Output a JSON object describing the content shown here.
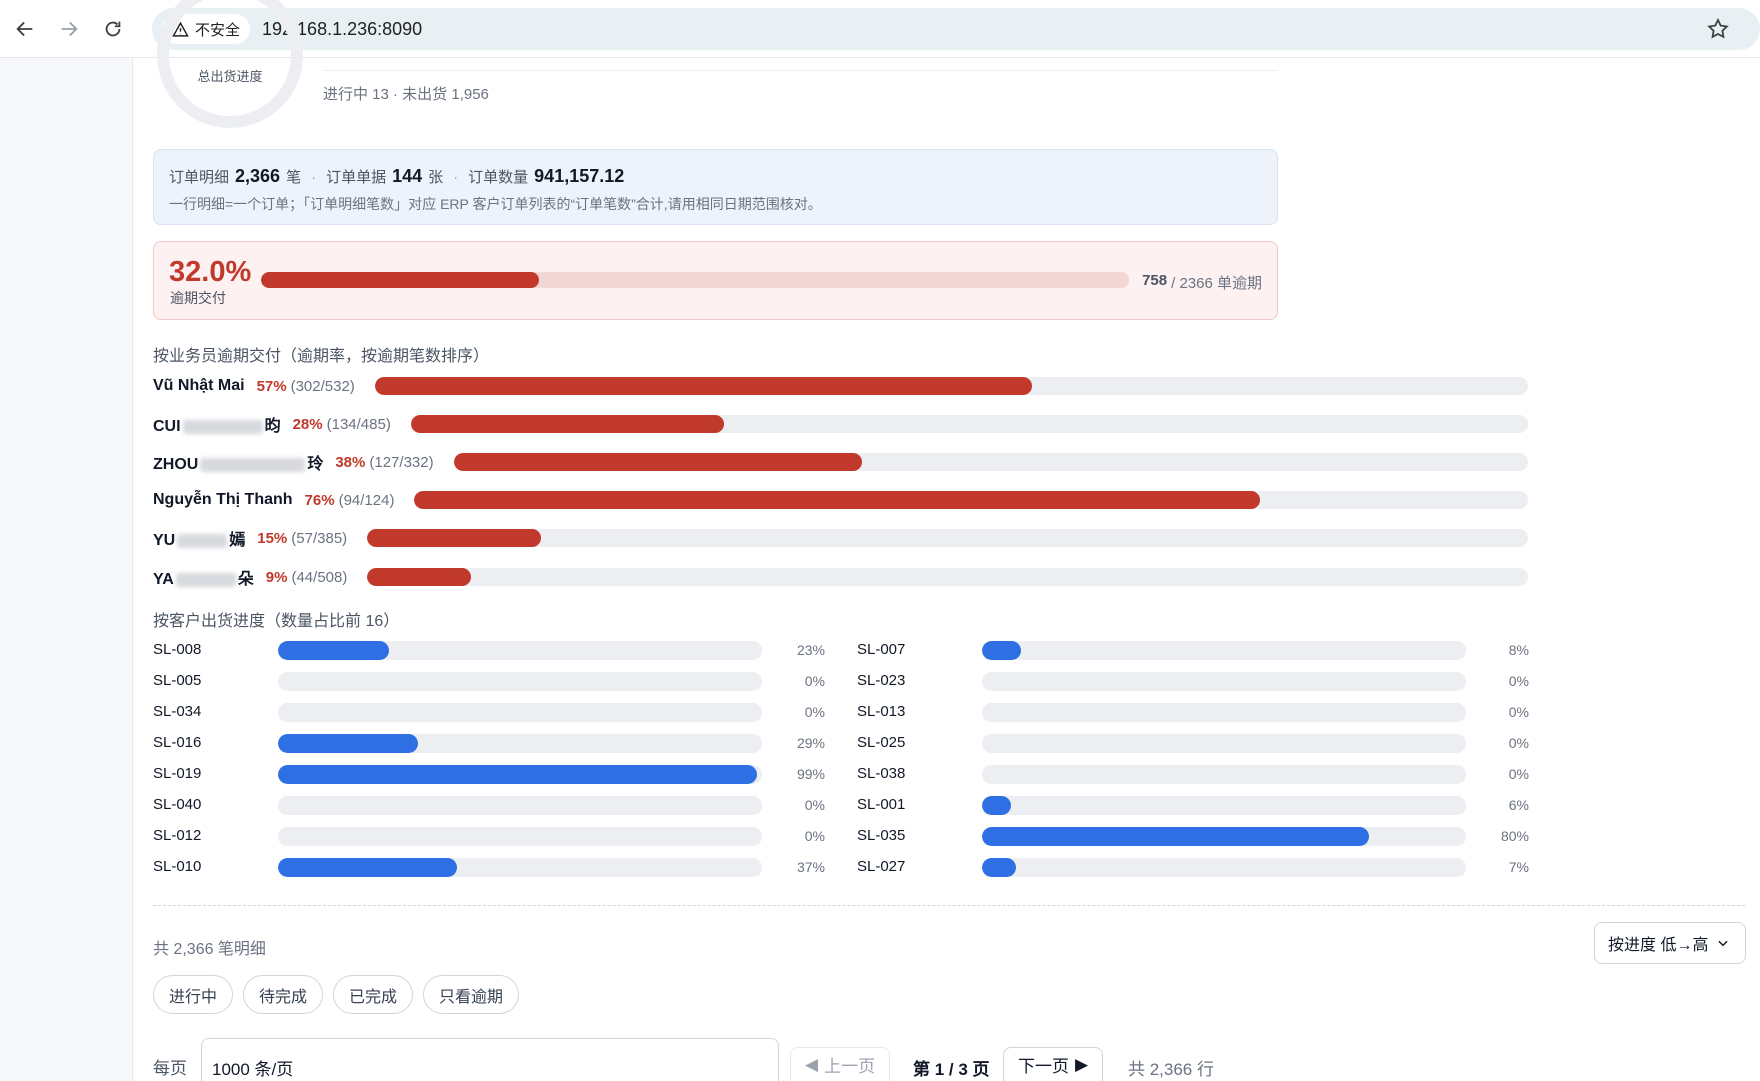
{
  "browser": {
    "security_label": "不安全",
    "url": "192.168.1.236:8090"
  },
  "progress_widget": {
    "center_label": "总出货进度",
    "sub_text": "进行中 13 · 未出货 1,956"
  },
  "summary": {
    "detail_label": "订单明细",
    "detail_value": "2,366",
    "detail_unit": "笔",
    "docs_label": "订单单据",
    "docs_value": "144",
    "docs_unit": "张",
    "qty_label": "订单数量",
    "qty_value": "941,157.12",
    "note": "一行明细=一个订单；「订单明细笔数」对应 ERP 客户订单列表的“订单笔数”合计,请用相同日期范围核对。"
  },
  "overdue": {
    "percent_text": "32.0%",
    "label": "逾期交付",
    "fraction": 0.32,
    "count": "758",
    "total_text": "/ 2366 单逾期"
  },
  "rep_section": {
    "title": "按业务员逾期交付（逾期率，按逾期笔数排序）",
    "reps": [
      {
        "name_a": "Vũ Nhật Mai",
        "name_b": "",
        "pct": "57%",
        "counts": "(302/532)",
        "rate": 0.57
      },
      {
        "name_a": "CUI",
        "name_b": "昀",
        "pct": "28%",
        "counts": "(134/485)",
        "rate": 0.28
      },
      {
        "name_a": "ZHOU",
        "name_b": "玲",
        "pct": "38%",
        "counts": "(127/332)",
        "rate": 0.38
      },
      {
        "name_a": "Nguyễn Thị Thanh",
        "name_b": "",
        "pct": "76%",
        "counts": "(94/124)",
        "rate": 0.76
      },
      {
        "name_a": "YU",
        "name_b": "嫣",
        "pct": "15%",
        "counts": "(57/385)",
        "rate": 0.15
      },
      {
        "name_a": "YA",
        "name_b": "朵",
        "pct": "9%",
        "counts": "(44/508)",
        "rate": 0.09
      }
    ]
  },
  "cust_section": {
    "title": "按客户出货进度（数量占比前 16）",
    "left": [
      {
        "code": "SL-008",
        "pct": "23%",
        "value": 0.23
      },
      {
        "code": "SL-005",
        "pct": "0%",
        "value": 0
      },
      {
        "code": "SL-034",
        "pct": "0%",
        "value": 0
      },
      {
        "code": "SL-016",
        "pct": "29%",
        "value": 0.29
      },
      {
        "code": "SL-019",
        "pct": "99%",
        "value": 0.99
      },
      {
        "code": "SL-040",
        "pct": "0%",
        "value": 0
      },
      {
        "code": "SL-012",
        "pct": "0%",
        "value": 0
      },
      {
        "code": "SL-010",
        "pct": "37%",
        "value": 0.37
      }
    ],
    "right": [
      {
        "code": "SL-007",
        "pct": "8%",
        "value": 0.08
      },
      {
        "code": "SL-023",
        "pct": "0%",
        "value": 0
      },
      {
        "code": "SL-013",
        "pct": "0%",
        "value": 0
      },
      {
        "code": "SL-025",
        "pct": "0%",
        "value": 0
      },
      {
        "code": "SL-038",
        "pct": "0%",
        "value": 0
      },
      {
        "code": "SL-001",
        "pct": "6%",
        "value": 0.06
      },
      {
        "code": "SL-035",
        "pct": "80%",
        "value": 0.8
      },
      {
        "code": "SL-027",
        "pct": "7%",
        "value": 0.07
      }
    ]
  },
  "list": {
    "total_text": "共 2,366 笔明细",
    "sort_label": "按进度 低→高",
    "filters": [
      "进行中",
      "待完成",
      "已完成",
      "只看逾期"
    ]
  },
  "pager": {
    "per_page_label": "每页",
    "per_page_value": "1000 条/页",
    "prev_label": "上一页",
    "page_text": "第 1 / 3 页",
    "next_label": "下一页",
    "rows_total": "共 2,366 行"
  },
  "colors": {
    "overdue_red": "#c0392b",
    "progress_blue": "#2f6fe4",
    "track_gray": "#eceef2"
  }
}
